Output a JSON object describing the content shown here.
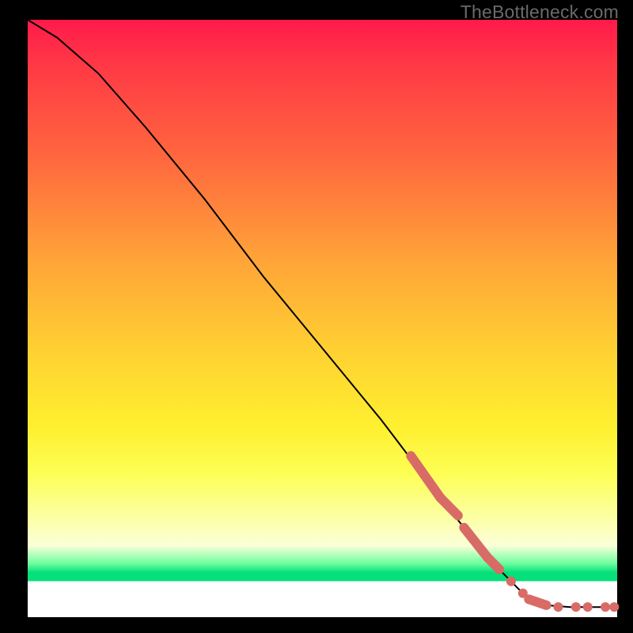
{
  "attribution": "TheBottleneck.com",
  "colors": {
    "marker": "#d96b67",
    "line": "#000000"
  },
  "chart_data": {
    "type": "line",
    "title": "",
    "xlabel": "",
    "ylabel": "",
    "xlim": [
      0,
      100
    ],
    "ylim": [
      0,
      100
    ],
    "grid": false,
    "legend": false,
    "curve_points": [
      {
        "x": 0,
        "y": 100
      },
      {
        "x": 5,
        "y": 97
      },
      {
        "x": 12,
        "y": 91
      },
      {
        "x": 20,
        "y": 82
      },
      {
        "x": 30,
        "y": 70
      },
      {
        "x": 40,
        "y": 57
      },
      {
        "x": 50,
        "y": 45
      },
      {
        "x": 60,
        "y": 33
      },
      {
        "x": 70,
        "y": 20
      },
      {
        "x": 78,
        "y": 10
      },
      {
        "x": 84,
        "y": 4
      },
      {
        "x": 88,
        "y": 2
      },
      {
        "x": 92,
        "y": 1.7
      },
      {
        "x": 100,
        "y": 1.7
      }
    ],
    "marker_clusters": [
      {
        "type": "segment",
        "x1": 65,
        "y1": 27,
        "x2": 70,
        "y2": 20
      },
      {
        "type": "segment",
        "x1": 70,
        "y1": 20,
        "x2": 73,
        "y2": 17
      },
      {
        "type": "segment",
        "x1": 74,
        "y1": 15,
        "x2": 78,
        "y2": 10
      },
      {
        "type": "segment",
        "x1": 78,
        "y1": 10,
        "x2": 80,
        "y2": 8
      },
      {
        "type": "dot",
        "x": 82,
        "y": 6
      },
      {
        "type": "dot",
        "x": 84,
        "y": 4
      },
      {
        "type": "segment",
        "x1": 85,
        "y1": 3,
        "x2": 88,
        "y2": 2
      },
      {
        "type": "dot",
        "x": 90,
        "y": 1.7
      },
      {
        "type": "dot",
        "x": 93,
        "y": 1.7
      },
      {
        "type": "dot",
        "x": 95,
        "y": 1.7
      },
      {
        "type": "dot",
        "x": 98,
        "y": 1.7
      },
      {
        "type": "dot",
        "x": 99.5,
        "y": 1.7
      }
    ]
  }
}
